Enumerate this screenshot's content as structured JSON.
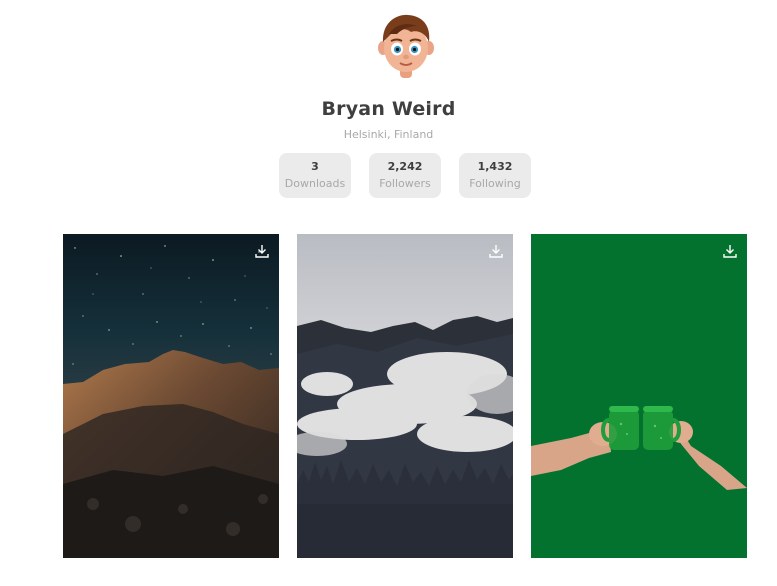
{
  "profile": {
    "name": "Bryan Weird",
    "location": "Helsinki, Finland",
    "avatar_icon": "cartoon-boy-avatar"
  },
  "stats": [
    {
      "value": "3",
      "label": "Downloads"
    },
    {
      "value": "2,242",
      "label": "Followers"
    },
    {
      "value": "1,432",
      "label": "Following"
    }
  ],
  "gallery": {
    "download_icon": "download-icon",
    "photos": [
      {
        "subject": "starry-night-mountain"
      },
      {
        "subject": "misty-forest-mountains-moon"
      },
      {
        "subject": "hands-toasting-green-beer"
      }
    ]
  },
  "colors": {
    "name_text": "#3f3f3f",
    "muted_text": "#a8a8a8",
    "stat_bg": "#ebebeb",
    "green_bg": "#03722f"
  }
}
